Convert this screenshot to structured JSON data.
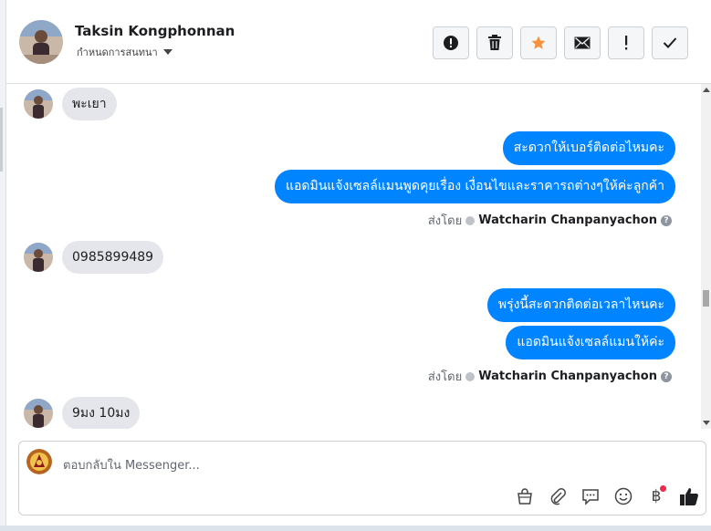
{
  "header": {
    "contact_name": "Taksin Kongphonnan",
    "subtitle": "กำหนดการสนทนา",
    "actions": [
      {
        "icon": "alert-circle-icon"
      },
      {
        "icon": "trash-icon"
      },
      {
        "icon": "star-icon",
        "color": "#f7923b"
      },
      {
        "icon": "envelope-icon"
      },
      {
        "icon": "exclamation-icon"
      },
      {
        "icon": "check-icon"
      }
    ]
  },
  "messages": [
    {
      "from": "customer",
      "text": "พะเยา"
    },
    {
      "from": "page",
      "text": "สะดวกให้เบอร์ติดต่อไหมคะ"
    },
    {
      "from": "page",
      "text": "แอดมินแจ้งเซลล์แมนพูดคุยเรื่อง เงื่อนไขและราคารถต่างๆให้ค่ะลูกค้า"
    },
    {
      "from": "sentby",
      "prefix": "ส่งโดย",
      "name": "Watcharin Chanpanyachon"
    },
    {
      "from": "customer",
      "text": "0985899489"
    },
    {
      "from": "page",
      "text": "พรุ่งนี้สะดวกติดต่อเวลาไหนคะ"
    },
    {
      "from": "page",
      "text": "แอดมินแจ้งเซลล์แมนให้ค่ะ"
    },
    {
      "from": "sentby",
      "prefix": "ส่งโดย",
      "name": "Watcharin Chanpanyachon"
    },
    {
      "from": "customer",
      "text": "9มง 10มง"
    }
  ],
  "composer": {
    "placeholder": "ตอบกลับใน Messenger...",
    "tools": [
      "bag-icon",
      "paperclip-icon",
      "speech-bubble-icon",
      "smiley-icon",
      "baht-icon",
      "thumbs-up-icon"
    ],
    "baht_symbol": "฿"
  },
  "colors": {
    "outgoing_bubble": "#0084ff",
    "incoming_bubble": "#e4e6eb",
    "notification_dot": "#f02849"
  }
}
